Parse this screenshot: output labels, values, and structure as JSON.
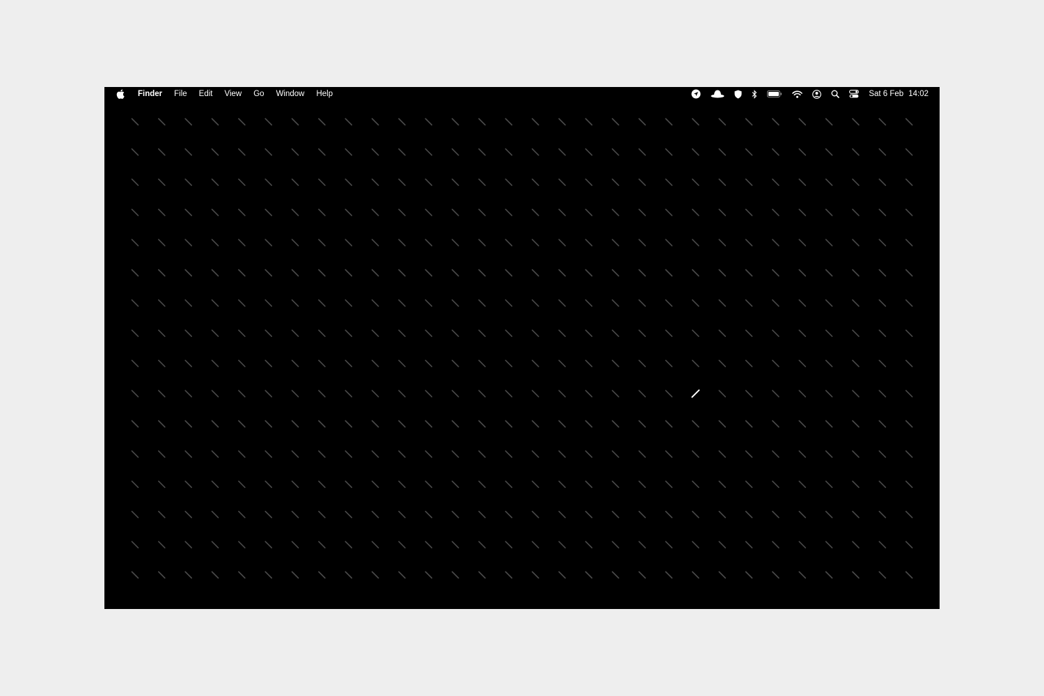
{
  "menubar": {
    "apple_icon": "apple-logo-icon",
    "app_name": "Finder",
    "menus": [
      "File",
      "Edit",
      "View",
      "Go",
      "Window",
      "Help"
    ],
    "status_icons": [
      "location-arrow-icon",
      "hat-icon",
      "shield-icon",
      "bluetooth-icon",
      "battery-icon",
      "wifi-icon",
      "user-account-icon",
      "spotlight-search-icon",
      "control-center-icon"
    ],
    "date": "Sat 6 Feb",
    "time": "14:02"
  },
  "desktop": {
    "background_color": "#000000",
    "pattern_stroke_color": "#4a4a4a",
    "highlight_stroke_color": "#ffffff"
  }
}
